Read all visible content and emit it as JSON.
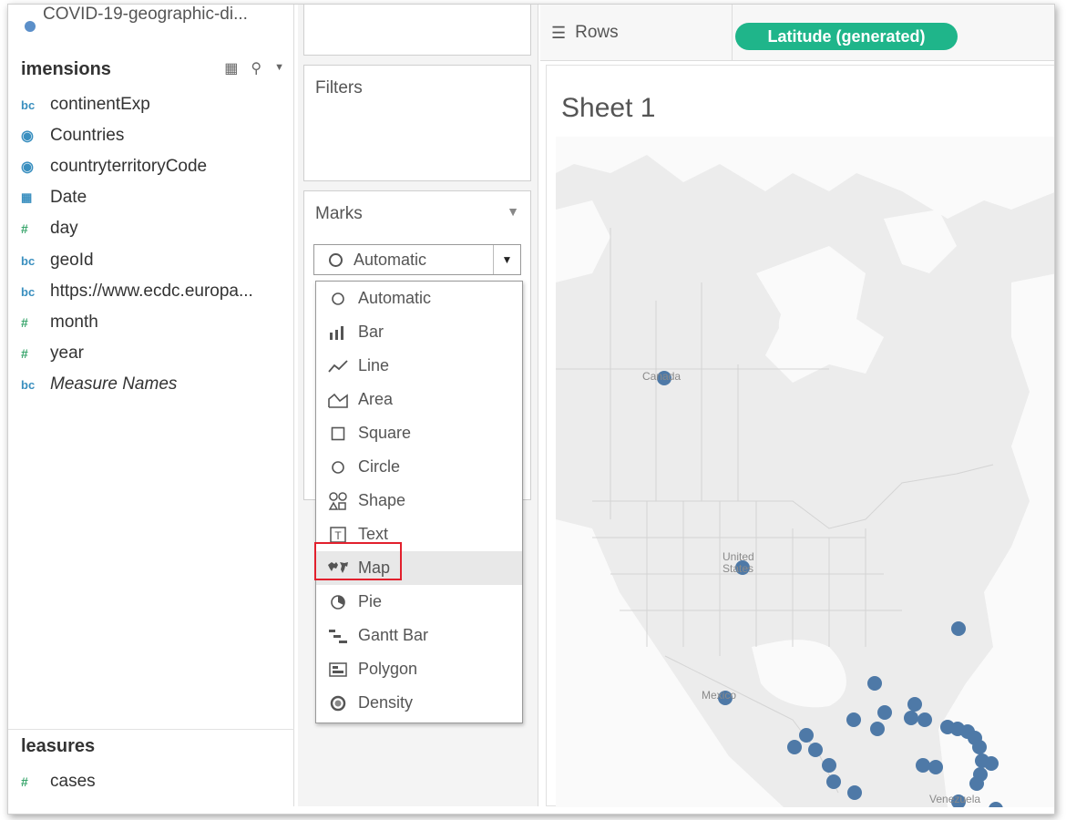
{
  "data_pane": {
    "datasource": "COVID-19-geographic-di...",
    "dimensions_header": "imensions",
    "measures_header": "leasures",
    "tool_icons": [
      "view-toggle-icon",
      "search-icon",
      "chevron-down-icon"
    ],
    "dimensions": [
      {
        "icon": "Abc",
        "label": "continentExp"
      },
      {
        "icon": "geo",
        "label": "Countries"
      },
      {
        "icon": "geo",
        "label": "countryterritoryCode"
      },
      {
        "icon": "date",
        "label": "Date"
      },
      {
        "icon": "#",
        "label": "day"
      },
      {
        "icon": "Abc",
        "label": "geoId"
      },
      {
        "icon": "Abc",
        "label": "https://www.ecdc.europa..."
      },
      {
        "icon": "#",
        "label": "month"
      },
      {
        "icon": "#",
        "label": "year"
      },
      {
        "icon": "Abc",
        "label": "Measure Names"
      }
    ],
    "measures": [
      {
        "icon": "#",
        "label": "cases"
      }
    ]
  },
  "filters_card": {
    "title": "Filters"
  },
  "marks_card": {
    "title": "Marks",
    "selected": "Automatic",
    "options": [
      "Automatic",
      "Bar",
      "Line",
      "Area",
      "Square",
      "Circle",
      "Shape",
      "Text",
      "Map",
      "Pie",
      "Gantt Bar",
      "Polygon",
      "Density"
    ],
    "highlighted": "Map"
  },
  "shelf": {
    "rows_label": "Rows",
    "rows_pill": "Latitude (generated)"
  },
  "view": {
    "sheet_title": "Sheet 1",
    "map_labels": {
      "canada": "Canada",
      "us": "United States",
      "mexico": "Mexico",
      "venezuela": "Venezuela"
    },
    "point_color": "#4e79a7"
  }
}
